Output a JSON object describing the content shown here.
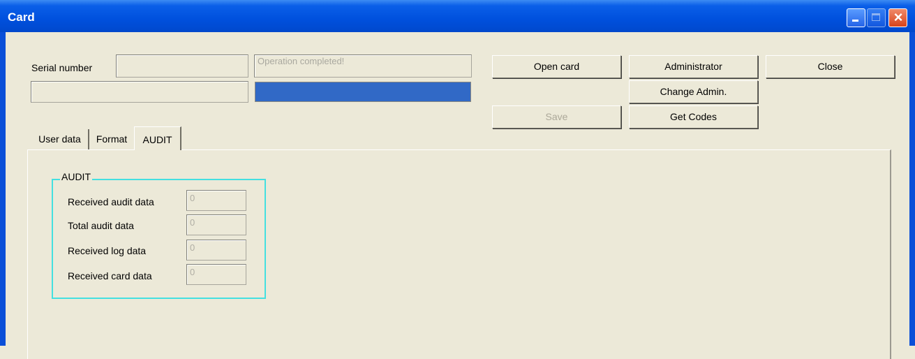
{
  "window": {
    "title": "Card"
  },
  "header": {
    "serial_label": "Serial number",
    "serial_value": "",
    "status_text": "Operation completed!",
    "second_field_value": "",
    "progress_fraction": 1.0
  },
  "buttons": {
    "open_card": "Open card",
    "save": "Save",
    "administrator": "Administrator",
    "change_admin": "Change Admin.",
    "get_codes": "Get Codes",
    "close": "Close"
  },
  "tabs": [
    {
      "label": "User data"
    },
    {
      "label": "Format"
    },
    {
      "label": "AUDIT"
    }
  ],
  "audit": {
    "group_title": "AUDIT",
    "rows": [
      {
        "label": "Received audit data",
        "value": "0"
      },
      {
        "label": "Total audit data",
        "value": "0"
      },
      {
        "label": "Received log data",
        "value": "0"
      },
      {
        "label": "Received card data",
        "value": "0"
      }
    ]
  },
  "colors": {
    "titlebar": "#0050dd",
    "progress": "#3169c6",
    "group_border": "#44e0e0",
    "face": "#ece9d8"
  }
}
